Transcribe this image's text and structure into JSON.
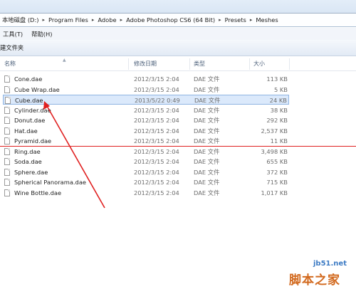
{
  "breadcrumbs": [
    "本地磁盘 (D:)",
    "Program Files",
    "Adobe",
    "Adobe Photoshop CS6 (64 Bit)",
    "Presets",
    "Meshes"
  ],
  "menu": {
    "tools": "工具(T)",
    "help": "帮助(H)"
  },
  "command": {
    "new_folder": "建文件夹"
  },
  "columns": {
    "name": "名称",
    "date": "修改日期",
    "type": "类型",
    "size": "大小"
  },
  "files": [
    {
      "name": "Cone.dae",
      "date": "2012/3/15 2:04",
      "type": "DAE 文件",
      "size": "113 KB"
    },
    {
      "name": "Cube Wrap.dae",
      "date": "2012/3/15 2:04",
      "type": "DAE 文件",
      "size": "5 KB"
    },
    {
      "name": "Cube.dae",
      "date": "2013/5/22 0:49",
      "type": "DAE 文件",
      "size": "24 KB"
    },
    {
      "name": "Cylinder.dae",
      "date": "2012/3/15 2:04",
      "type": "DAE 文件",
      "size": "38 KB"
    },
    {
      "name": "Donut.dae",
      "date": "2012/3/15 2:04",
      "type": "DAE 文件",
      "size": "292 KB"
    },
    {
      "name": "Hat.dae",
      "date": "2012/3/15 2:04",
      "type": "DAE 文件",
      "size": "2,537 KB"
    },
    {
      "name": "Pyramid.dae",
      "date": "2012/3/15 2:04",
      "type": "DAE 文件",
      "size": "11 KB"
    },
    {
      "name": "Ring.dae",
      "date": "2012/3/15 2:04",
      "type": "DAE 文件",
      "size": "3,498 KB"
    },
    {
      "name": "Soda.dae",
      "date": "2012/3/15 2:04",
      "type": "DAE 文件",
      "size": "655 KB"
    },
    {
      "name": "Sphere.dae",
      "date": "2012/3/15 2:04",
      "type": "DAE 文件",
      "size": "372 KB"
    },
    {
      "name": "Spherical Panorama.dae",
      "date": "2012/3/15 2:04",
      "type": "DAE 文件",
      "size": "715 KB"
    },
    {
      "name": "Wine Bottle.dae",
      "date": "2012/3/15 2:04",
      "type": "DAE 文件",
      "size": "1,017 KB"
    }
  ],
  "selected_file": "Cube.dae",
  "watermark": {
    "url": "jb51.net",
    "text": "脚本之家"
  },
  "colors": {
    "accent_selection": "#dbe9fb",
    "annotation": "#e02020"
  }
}
